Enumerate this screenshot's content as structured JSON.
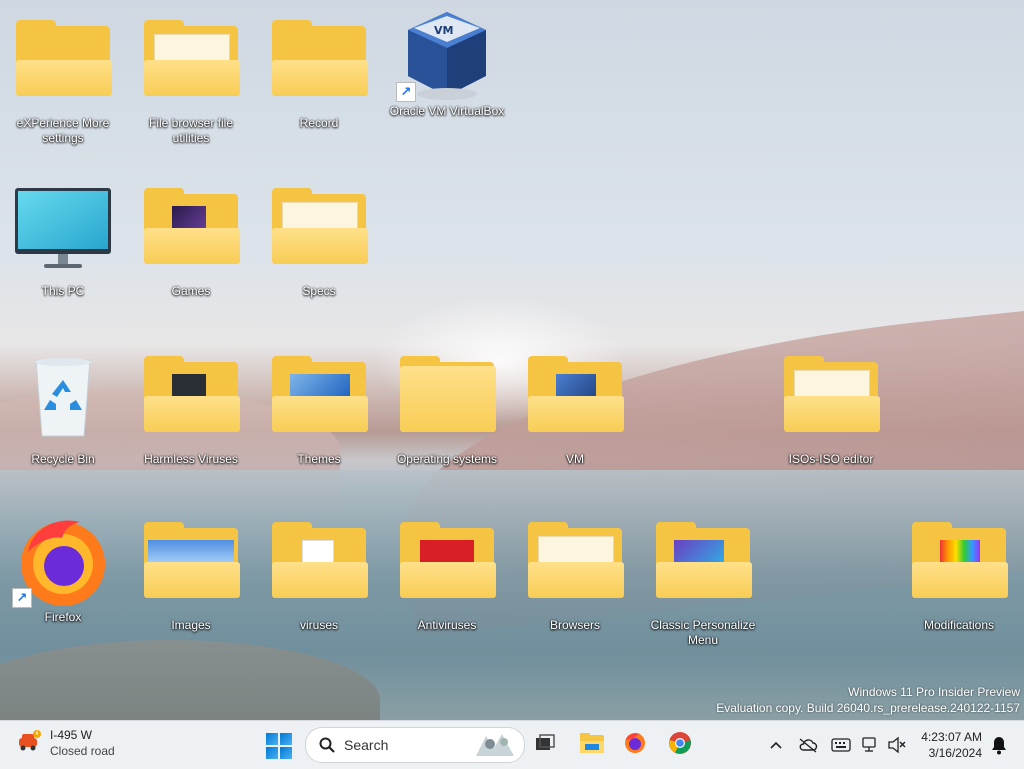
{
  "desktop": {
    "icons": [
      {
        "label": "eXPerience More settings",
        "type": "folder"
      },
      {
        "label": "File browser file utilities",
        "type": "folder"
      },
      {
        "label": "Record",
        "type": "folder"
      },
      {
        "label": "Oracle VM VirtualBox",
        "type": "app-shortcut",
        "icon": "virtualbox-icon"
      },
      {
        "label": "This PC",
        "type": "system",
        "icon": "monitor-icon"
      },
      {
        "label": "Games",
        "type": "folder"
      },
      {
        "label": "Specs",
        "type": "folder"
      },
      {
        "label": "Recycle Bin",
        "type": "system",
        "icon": "recycle-bin-icon"
      },
      {
        "label": "Harmless Viruses",
        "type": "folder"
      },
      {
        "label": "Themes",
        "type": "folder"
      },
      {
        "label": "Operating systems",
        "type": "folder"
      },
      {
        "label": "VM",
        "type": "folder"
      },
      {
        "label": "ISOs-ISO editor",
        "type": "folder"
      },
      {
        "label": "Firefox",
        "type": "app-shortcut",
        "icon": "firefox-icon"
      },
      {
        "label": "Images",
        "type": "folder"
      },
      {
        "label": "viruses",
        "type": "folder"
      },
      {
        "label": "Antiviruses",
        "type": "folder"
      },
      {
        "label": "Browsers",
        "type": "folder"
      },
      {
        "label": "Classic Personalize Menu",
        "type": "folder"
      },
      {
        "label": "Modifications",
        "type": "folder"
      }
    ],
    "watermark": {
      "line1": "Windows 11 Pro Insider Preview",
      "line2": "Evaluation copy. Build 26040.rs_prerelease.240122-1157"
    }
  },
  "taskbar": {
    "weather": {
      "title": "I-495 W",
      "subtitle": "Closed road",
      "icon": "traffic-car-icon"
    },
    "start_icon": "windows-start-icon",
    "search": {
      "placeholder": "Search"
    },
    "pinned": [
      {
        "name": "task-view-button",
        "icon": "task-view-icon"
      },
      {
        "name": "file-explorer-button",
        "icon": "file-explorer-icon"
      },
      {
        "name": "firefox-taskbar-button",
        "icon": "firefox-icon"
      },
      {
        "name": "chrome-taskbar-button",
        "icon": "chrome-icon"
      }
    ],
    "tray": {
      "icons": [
        "chevron-up-icon",
        "cloud-off-icon",
        "keyboard-icon",
        "network-icon",
        "volume-muted-icon"
      ],
      "time": "4:23:07 AM",
      "date": "3/16/2024",
      "notification_icon": "bell-icon"
    }
  }
}
